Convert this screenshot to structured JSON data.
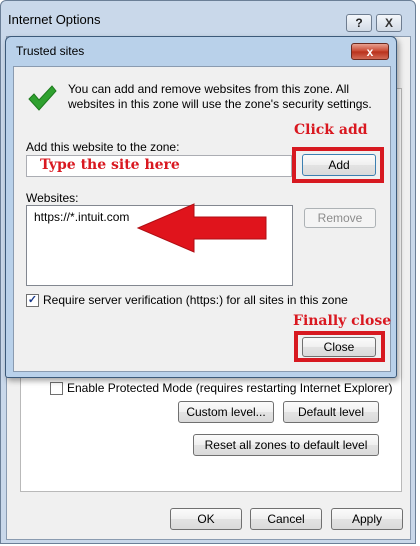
{
  "background_window": {
    "title": "Internet Options",
    "help_glyph": "?",
    "close_glyph": "X",
    "protected_mode_label": "Enable Protected Mode (requires restarting Internet Explorer)",
    "custom_level_label": "Custom level...",
    "default_level_label": "Default level",
    "reset_all_label": "Reset all zones to default level",
    "ok_label": "OK",
    "cancel_label": "Cancel",
    "apply_label": "Apply"
  },
  "dialog": {
    "title": "Trusted sites",
    "close_glyph": "x",
    "info_text": "You can add and remove websites from this zone. All websites in this zone will use the zone's security settings.",
    "add_label": "Add this website to the zone:",
    "site_input_value": "",
    "add_button": "Add",
    "websites_label": "Websites:",
    "websites": [
      "https://*.intuit.com"
    ],
    "remove_button": "Remove",
    "require_verification_label": "Require server verification (https:) for all sites in this zone",
    "require_verification_checked": true,
    "close_button": "Close"
  },
  "annotations": {
    "click_add": "Click add",
    "type_site": "Type the site here",
    "finally_close": "Finally close",
    "color": "#d91820"
  },
  "icons": {
    "info": "green-checkmark-icon",
    "pointer": "red-arrow-icon"
  }
}
